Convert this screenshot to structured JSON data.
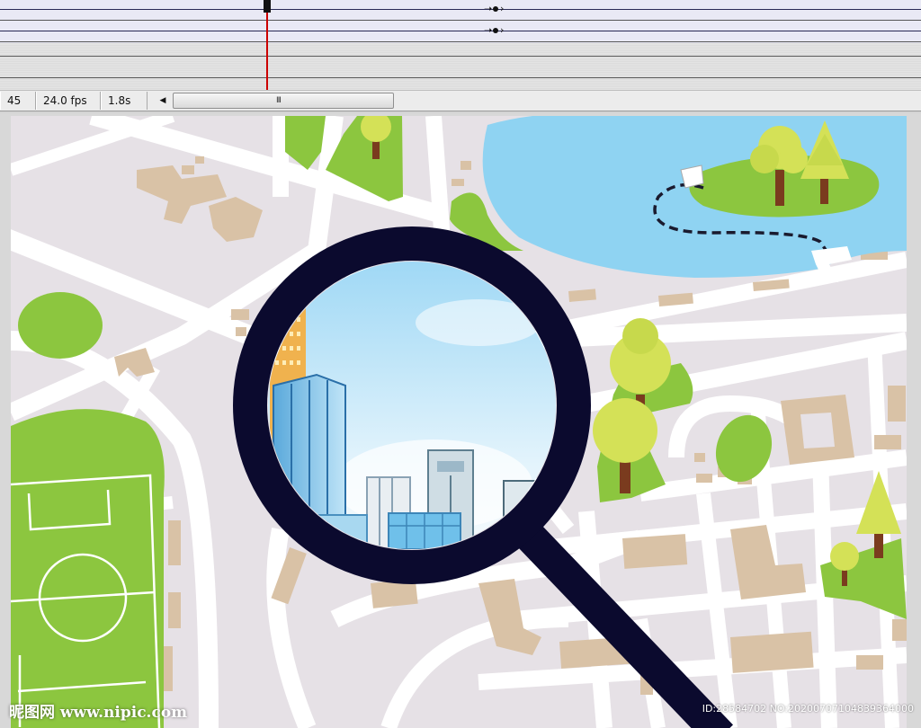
{
  "timeline": {
    "frame_number": "45",
    "frame_rate": "24.0 fps",
    "elapsed_time": "1.8s",
    "scroll_grip": "III",
    "scroll_left_arrow": "◀"
  },
  "map": {
    "icons": [
      "magnifier-icon",
      "tree-icon",
      "soccer-field",
      "lake",
      "city-skyline"
    ]
  },
  "watermark": {
    "site": "昵图网 www.nipic.com",
    "id_text": "ID:28584702 NO:20200707104839364000"
  },
  "colors": {
    "road": "#ffffff",
    "block": "#e6e1e6",
    "building": "#d9c2a6",
    "park": "#8cc63f",
    "water": "#8fd3f2",
    "tree_canopy": "#d4e157",
    "tree_trunk": "#7a3b1e",
    "magnifier": "#0b0a2e",
    "timeline_playhead": "#cc0000"
  }
}
